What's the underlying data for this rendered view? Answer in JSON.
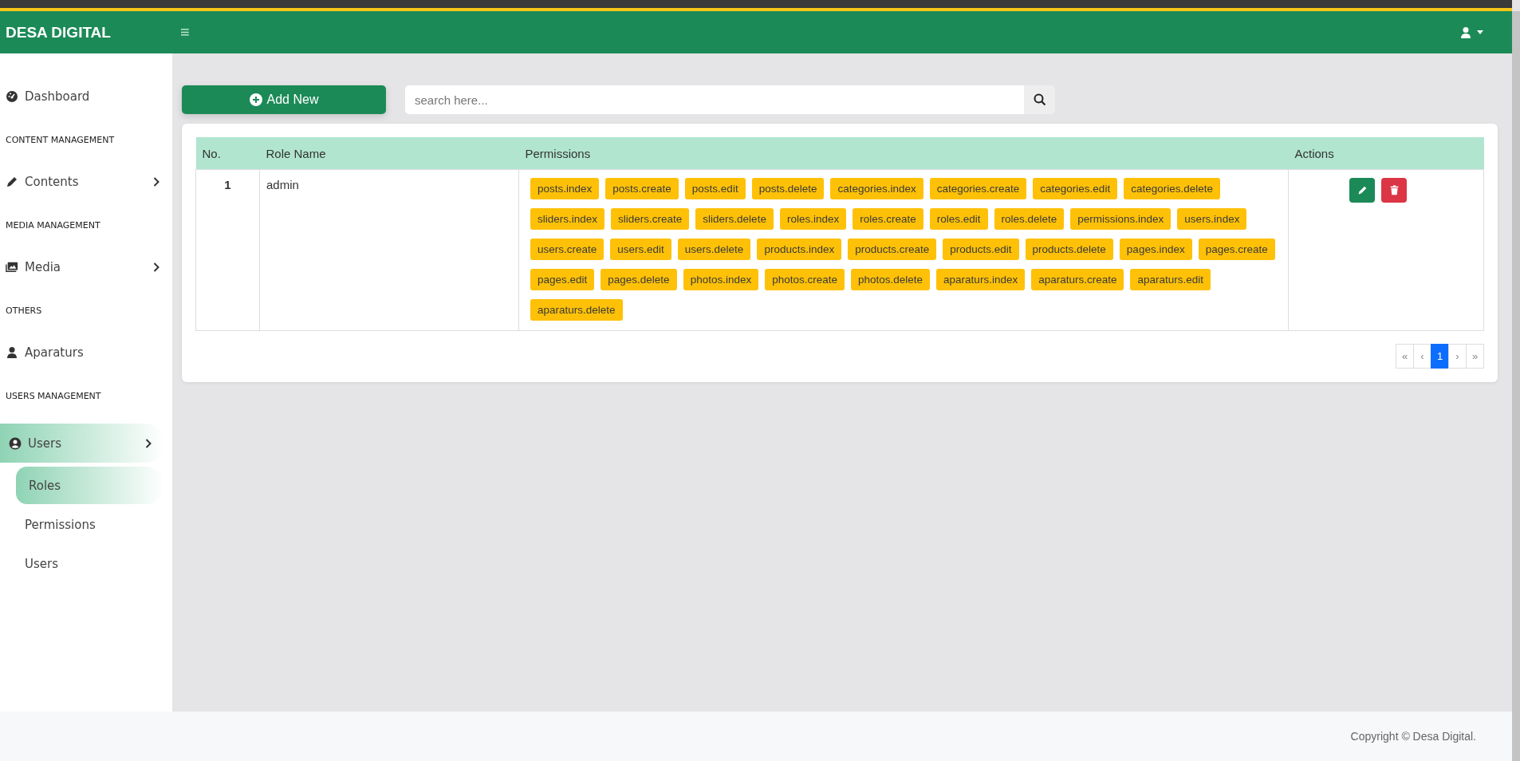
{
  "header": {
    "brand": "DESA DIGITAL",
    "menu_toggle": "≡"
  },
  "sidebar": {
    "items": [
      {
        "kind": "link",
        "label": "Dashboard",
        "selected": false
      },
      {
        "kind": "heading",
        "label": "CONTENT MANAGEMENT"
      },
      {
        "kind": "group",
        "label": "Contents",
        "selected": false
      },
      {
        "kind": "heading",
        "label": "MEDIA MANAGEMENT"
      },
      {
        "kind": "group",
        "label": "Media",
        "selected": false
      },
      {
        "kind": "heading",
        "label": "OTHERS"
      },
      {
        "kind": "link",
        "label": "Aparaturs",
        "selected": false
      },
      {
        "kind": "heading",
        "label": "USERS MANAGEMENT"
      },
      {
        "kind": "group",
        "label": "Users",
        "selected": true,
        "children": [
          {
            "label": "Roles",
            "selected": true
          },
          {
            "label": "Permissions",
            "selected": false
          },
          {
            "label": "Users",
            "selected": false
          }
        ]
      }
    ]
  },
  "toolbar": {
    "add_button": "Add New",
    "search": {
      "placeholder": "search here..."
    }
  },
  "table": {
    "columns": [
      "No.",
      "Role Name",
      "Permissions",
      "Actions"
    ],
    "rows": [
      {
        "no": "1",
        "role_name": "admin",
        "permissions": [
          "posts.index",
          "posts.create",
          "posts.edit",
          "posts.delete",
          "categories.index",
          "categories.create",
          "categories.edit",
          "categories.delete",
          "sliders.index",
          "sliders.create",
          "sliders.delete",
          "roles.index",
          "roles.create",
          "roles.edit",
          "roles.delete",
          "permissions.index",
          "users.index",
          "users.create",
          "users.edit",
          "users.delete",
          "products.index",
          "products.create",
          "products.edit",
          "products.delete",
          "pages.index",
          "pages.create",
          "pages.edit",
          "pages.delete",
          "photos.index",
          "photos.create",
          "photos.delete",
          "aparaturs.index",
          "aparaturs.create",
          "aparaturs.edit",
          "aparaturs.delete"
        ]
      }
    ]
  },
  "pagination": [
    {
      "label": "«",
      "selected": false
    },
    {
      "label": "‹",
      "selected": false
    },
    {
      "label": "1",
      "selected": true
    },
    {
      "label": "›",
      "selected": false
    },
    {
      "label": "»",
      "selected": false
    }
  ],
  "footer": {
    "copyright": "Copyright © Desa Digital."
  }
}
